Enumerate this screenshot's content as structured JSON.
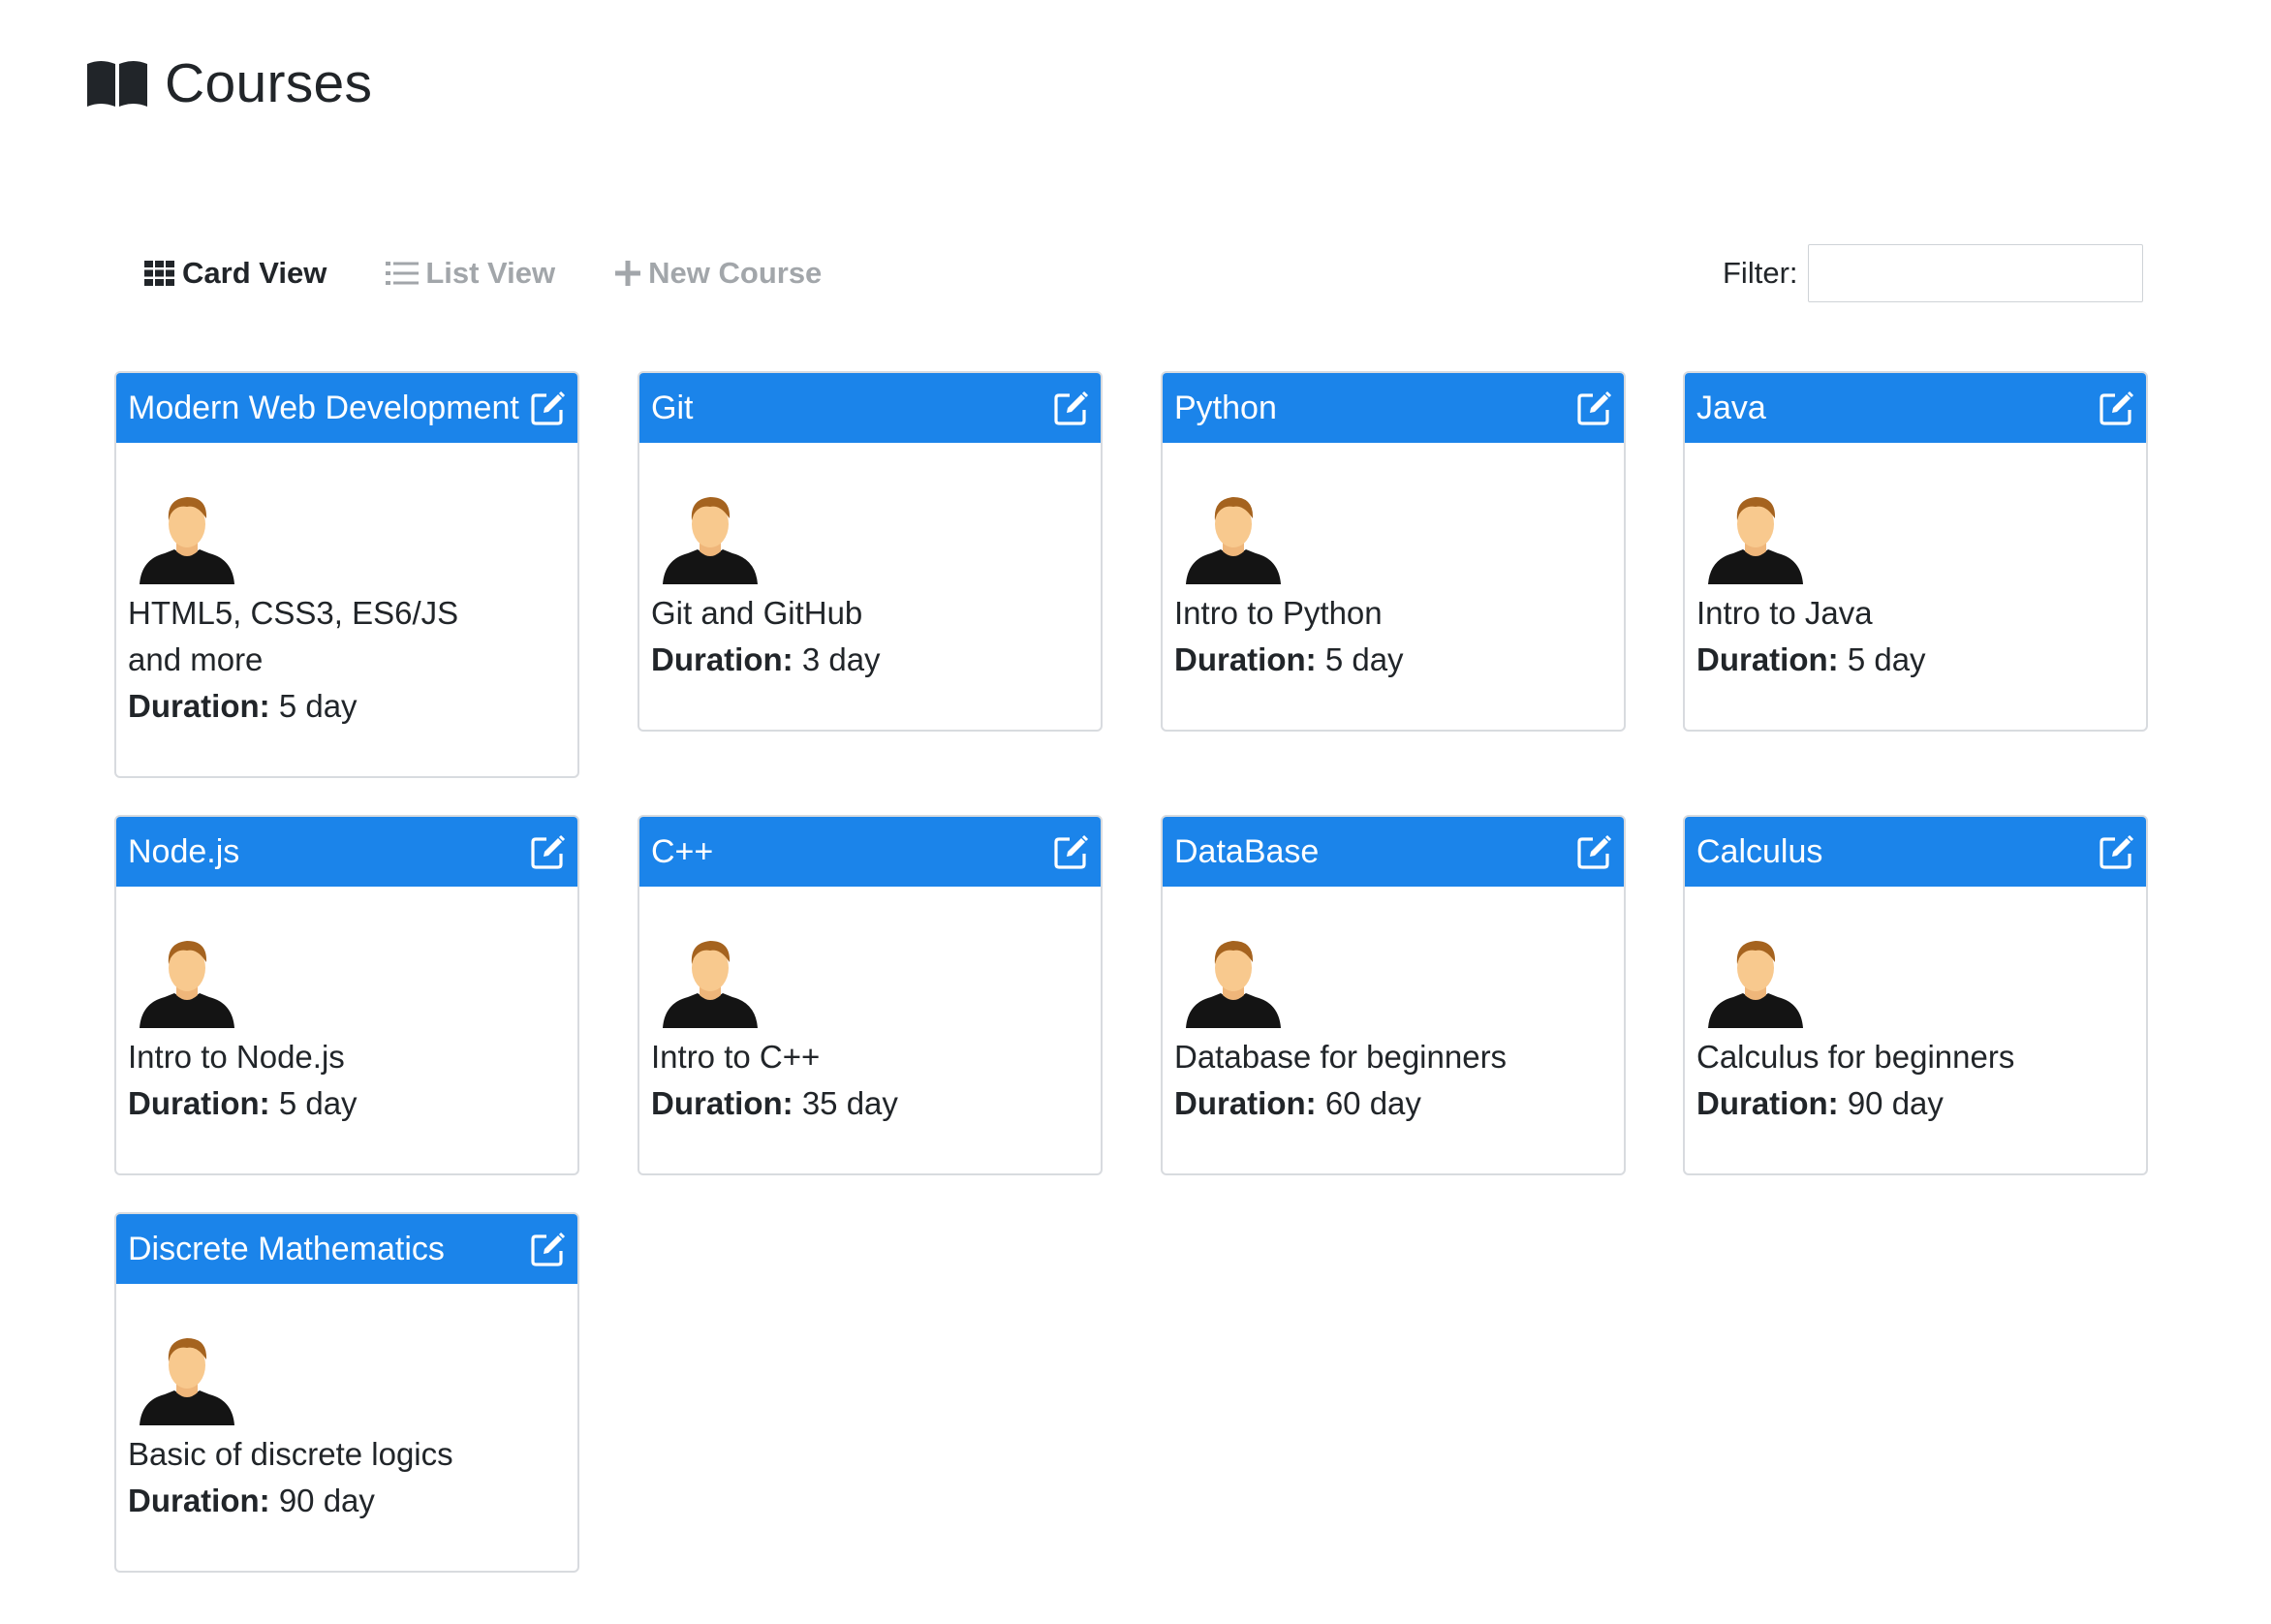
{
  "page": {
    "title": "Courses"
  },
  "toolbar": {
    "card_view": "Card View",
    "list_view": "List View",
    "new_course": "New Course",
    "filter_label": "Filter:",
    "filter_value": ""
  },
  "colors": {
    "header": "#1b84ea",
    "muted": "#a2a6aa"
  },
  "duration_label": "Duration:",
  "courses": [
    {
      "title": "Modern Web Development",
      "description": "HTML5, CSS3, ES6/JS and more",
      "duration": "5 day"
    },
    {
      "title": "Git",
      "description": "Git and GitHub",
      "duration": "3 day"
    },
    {
      "title": "Python",
      "description": "Intro to Python",
      "duration": "5 day"
    },
    {
      "title": "Java",
      "description": "Intro to Java",
      "duration": "5 day"
    },
    {
      "title": "Node.js",
      "description": "Intro to Node.js",
      "duration": "5 day"
    },
    {
      "title": "C++",
      "description": "Intro to C++",
      "duration": "35 day"
    },
    {
      "title": "DataBase",
      "description": "Database for beginners",
      "duration": "60 day"
    },
    {
      "title": "Calculus",
      "description": "Calculus for beginners",
      "duration": "90 day"
    },
    {
      "title": "Discrete Mathematics",
      "description": "Basic of discrete logics",
      "duration": "90 day"
    }
  ]
}
